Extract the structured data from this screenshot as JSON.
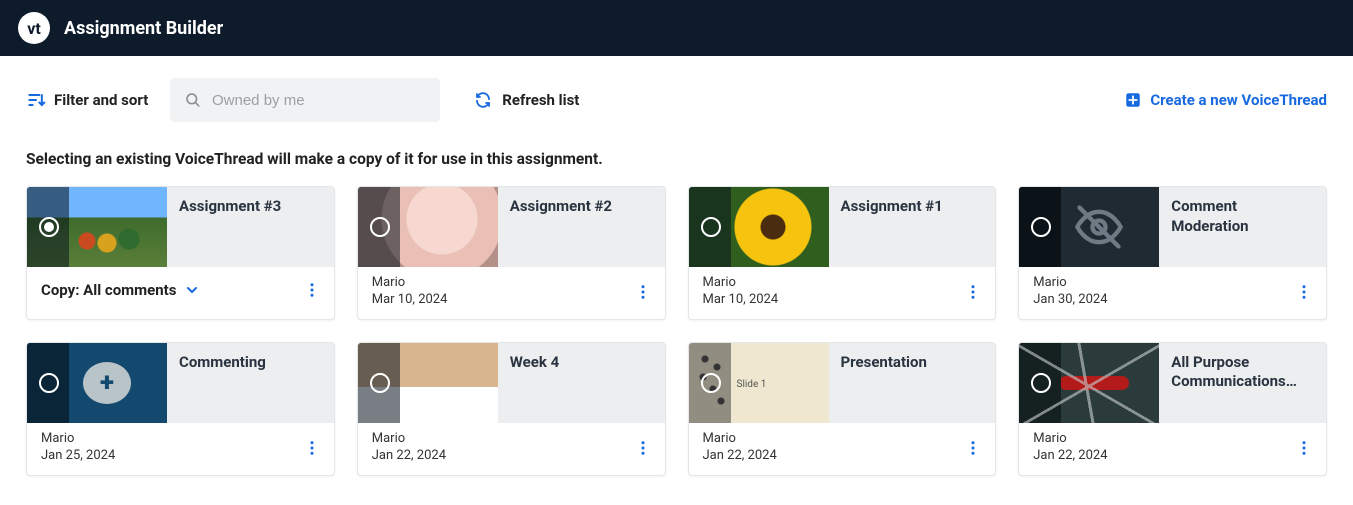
{
  "header": {
    "logo_text": "vt",
    "title": "Assignment Builder"
  },
  "toolbar": {
    "filter_sort_label": "Filter and sort",
    "search_placeholder": "Owned by me",
    "refresh_label": "Refresh list",
    "create_label": "Create a new VoiceThread"
  },
  "instruction": "Selecting an existing VoiceThread will make a copy of it for use in this assignment.",
  "copy_dropdown_label": "Copy: All comments",
  "cards": [
    {
      "title": "Assignment #3",
      "author": "",
      "date": "",
      "selected": true,
      "thumb": "scenic",
      "show_copy_dropdown": true
    },
    {
      "title": "Assignment #2",
      "author": "Mario",
      "date": "Mar 10, 2024",
      "selected": false,
      "thumb": "kitten"
    },
    {
      "title": "Assignment #1",
      "author": "Mario",
      "date": "Mar 10, 2024",
      "selected": false,
      "thumb": "sunflower"
    },
    {
      "title": "Comment Moderation",
      "author": "Mario",
      "date": "Jan 30, 2024",
      "selected": false,
      "thumb": "hidden"
    },
    {
      "title": "Commenting",
      "author": "Mario",
      "date": "Jan 25, 2024",
      "selected": false,
      "thumb": "commenting"
    },
    {
      "title": "Week 4",
      "author": "Mario",
      "date": "Jan 22, 2024",
      "selected": false,
      "thumb": "cat"
    },
    {
      "title": "Presentation",
      "author": "Mario",
      "date": "Jan 22, 2024",
      "selected": false,
      "thumb": "slide",
      "slide_text": "Slide 1"
    },
    {
      "title": "All Purpose Communications…",
      "author": "Mario",
      "date": "Jan 22, 2024",
      "selected": false,
      "thumb": "knife"
    }
  ]
}
